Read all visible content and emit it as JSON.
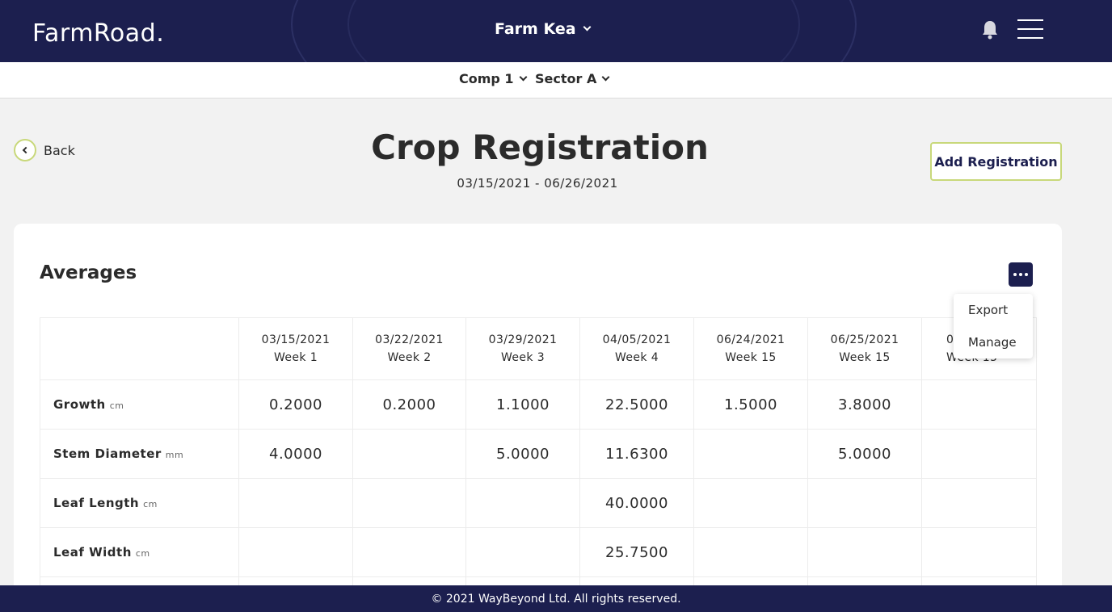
{
  "header": {
    "logo": "FarmRoad.",
    "farm_selector": "Farm Kea",
    "icons": {
      "notification": "bell-icon",
      "menu": "hamburger-menu-icon"
    }
  },
  "subnav": {
    "comp_selector": "Comp 1",
    "sector_selector": "Sector A"
  },
  "page": {
    "back_label": "Back",
    "title": "Crop Registration",
    "date_range": "03/15/2021 - 06/26/2021",
    "add_button": "Add Registration"
  },
  "averages": {
    "title": "Averages",
    "menu_items": [
      "Export",
      "Manage"
    ],
    "columns": [
      {
        "date": "03/15/2021",
        "week": "Week 1"
      },
      {
        "date": "03/22/2021",
        "week": "Week 2"
      },
      {
        "date": "03/29/2021",
        "week": "Week 3"
      },
      {
        "date": "04/05/2021",
        "week": "Week 4"
      },
      {
        "date": "06/24/2021",
        "week": "Week 15"
      },
      {
        "date": "06/25/2021",
        "week": "Week 15"
      },
      {
        "date": "0",
        "week": "Week 15"
      }
    ],
    "rows": [
      {
        "label": "Growth",
        "unit": "cm",
        "values": [
          "0.2000",
          "0.2000",
          "1.1000",
          "22.5000",
          "1.5000",
          "3.8000",
          ""
        ]
      },
      {
        "label": "Stem Diameter",
        "unit": "mm",
        "values": [
          "4.0000",
          "",
          "5.0000",
          "11.6300",
          "",
          "5.0000",
          ""
        ]
      },
      {
        "label": "Leaf Length",
        "unit": "cm",
        "values": [
          "",
          "",
          "",
          "40.0000",
          "",
          "",
          ""
        ]
      },
      {
        "label": "Leaf Width",
        "unit": "cm",
        "values": [
          "",
          "",
          "",
          "25.7500",
          "",
          "",
          ""
        ]
      }
    ]
  },
  "footer": {
    "text": "© 2021 WayBeyond Ltd. All rights reserved."
  },
  "colors": {
    "navy": "#1c1f4f",
    "accent": "#c8d87a",
    "background": "#f2f2f2"
  }
}
